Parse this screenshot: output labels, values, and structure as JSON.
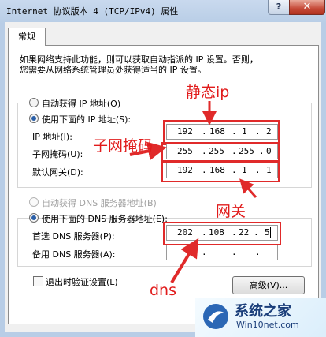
{
  "window": {
    "title": "Internet 协议版本 4 (TCP/IPv4) 属性",
    "help_button": "?",
    "close_button": "✕"
  },
  "tab": {
    "label": "常规"
  },
  "description": {
    "line1": "如果网络支持此功能，则可以获取自动指派的 IP 设置。否则，",
    "line2": "您需要从网络系统管理员处获得适当的 IP 设置。"
  },
  "ip_section": {
    "auto_option": "自动获得 IP 地址(O)",
    "manual_option": "使用下面的 IP 地址(S):",
    "selected": "manual",
    "fields": [
      {
        "label": "IP 地址(I):",
        "octets": [
          "192",
          "168",
          "1",
          "2"
        ]
      },
      {
        "label": "子网掩码(U):",
        "octets": [
          "255",
          "255",
          "255",
          "0"
        ]
      },
      {
        "label": "默认网关(D):",
        "octets": [
          "192",
          "168",
          "1",
          "1"
        ]
      }
    ]
  },
  "dns_section": {
    "auto_option": "自动获得 DNS 服务器地址(B)",
    "manual_option": "使用下面的 DNS 服务器地址(E):",
    "selected": "manual",
    "fields": [
      {
        "label": "首选 DNS 服务器(P):",
        "octets": [
          "202",
          "108",
          "22",
          "5"
        ]
      },
      {
        "label": "备用 DNS 服务器(A):",
        "octets": [
          "",
          "",
          "",
          ""
        ]
      }
    ]
  },
  "validate_checkbox": {
    "label": "退出时验证设置(L)",
    "checked": false
  },
  "advanced_button": {
    "label": "高级(V)..."
  },
  "annotations": {
    "static_ip": "静态ip",
    "subnet_mask": "子网掩码",
    "gateway": "网关",
    "dns": "dns"
  },
  "watermark": {
    "brand": "系统之家",
    "site": "Win10net.com"
  },
  "colors": {
    "annotation_red": "#e02a2a",
    "selection_blue": "#2a5fa8"
  }
}
